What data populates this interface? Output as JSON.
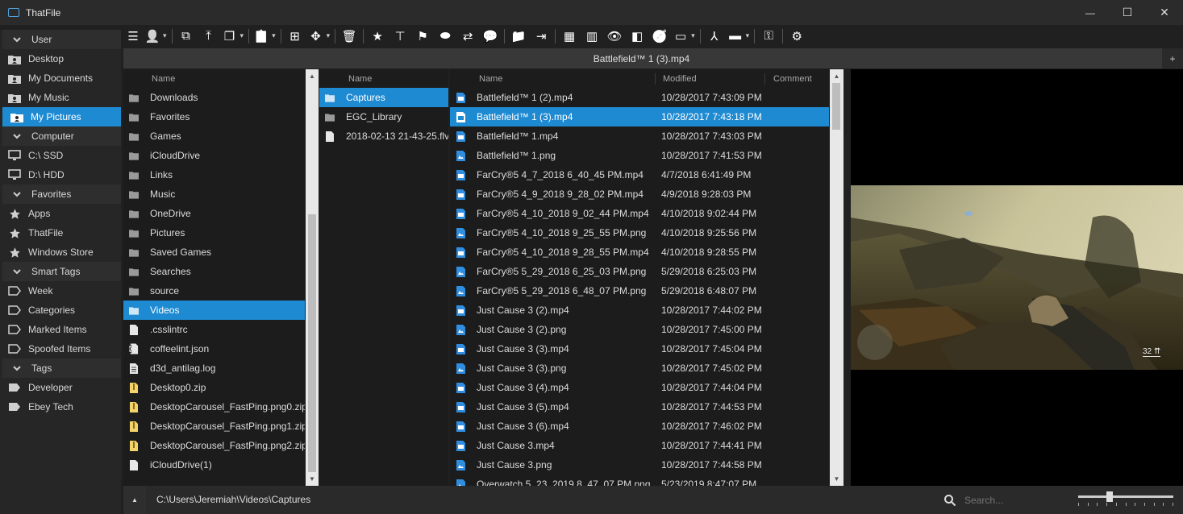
{
  "window": {
    "title": "ThatFile",
    "controls": {
      "minimize": "—",
      "maximize": "☐",
      "close": "✕"
    }
  },
  "sidebar": {
    "items": [
      {
        "label": "User",
        "kind": "header",
        "icon": "chevron-down"
      },
      {
        "label": "Desktop",
        "kind": "item",
        "icon": "user-folder"
      },
      {
        "label": "My Documents",
        "kind": "item",
        "icon": "user-folder"
      },
      {
        "label": "My Music",
        "kind": "item",
        "icon": "user-folder"
      },
      {
        "label": "My Pictures",
        "kind": "item",
        "icon": "user-folder",
        "active": true
      },
      {
        "label": "Computer",
        "kind": "header",
        "icon": "chevron-down"
      },
      {
        "label": "C:\\ SSD",
        "kind": "item",
        "icon": "monitor"
      },
      {
        "label": "D:\\ HDD",
        "kind": "item",
        "icon": "monitor"
      },
      {
        "label": "Favorites",
        "kind": "header",
        "icon": "chevron-down"
      },
      {
        "label": "Apps",
        "kind": "item",
        "icon": "star"
      },
      {
        "label": "ThatFile",
        "kind": "item",
        "icon": "star"
      },
      {
        "label": "Windows Store",
        "kind": "item",
        "icon": "star"
      },
      {
        "label": "Smart Tags",
        "kind": "header",
        "icon": "chevron-down"
      },
      {
        "label": "Week",
        "kind": "item",
        "icon": "tag-outline"
      },
      {
        "label": "Categories",
        "kind": "item",
        "icon": "tag-outline"
      },
      {
        "label": "Marked Items",
        "kind": "item",
        "icon": "tag-outline"
      },
      {
        "label": "Spoofed Items",
        "kind": "item",
        "icon": "tag-outline"
      },
      {
        "label": "Tags",
        "kind": "header",
        "icon": "chevron-down"
      },
      {
        "label": "Developer",
        "kind": "item",
        "icon": "tag"
      },
      {
        "label": "Ebey Tech",
        "kind": "item",
        "icon": "tag"
      }
    ]
  },
  "toolbar": {
    "buttons": [
      {
        "name": "menu",
        "glyph": "☰",
        "w": 24
      },
      {
        "name": "user",
        "glyph": "👤",
        "w": 24,
        "dropdown": true
      },
      {
        "sep": true
      },
      {
        "name": "open-external",
        "glyph": "⧉",
        "w": 28
      },
      {
        "name": "move-up",
        "glyph": "⤒",
        "w": 28
      },
      {
        "name": "copy",
        "glyph": "❐",
        "w": 24,
        "dropdown": true
      },
      {
        "sep": true
      },
      {
        "name": "paste",
        "glyph": "📋",
        "w": 24,
        "dropdown": true
      },
      {
        "sep": true
      },
      {
        "name": "new-item",
        "glyph": "⊞",
        "w": 28
      },
      {
        "name": "move",
        "glyph": "✥",
        "w": 24,
        "dropdown": true
      },
      {
        "sep": true
      },
      {
        "name": "delete",
        "glyph": "🗑",
        "w": 28
      },
      {
        "sep": true
      },
      {
        "name": "favorite",
        "glyph": "★",
        "w": 28
      },
      {
        "name": "pin-top",
        "glyph": "⊤",
        "w": 28
      },
      {
        "name": "flag",
        "glyph": "⚑",
        "w": 28
      },
      {
        "name": "tag",
        "glyph": "⬬",
        "w": 28
      },
      {
        "name": "swap",
        "glyph": "⇄",
        "w": 28
      },
      {
        "name": "comment",
        "glyph": "💬",
        "w": 28
      },
      {
        "sep": true
      },
      {
        "name": "folder",
        "glyph": "📁",
        "w": 28
      },
      {
        "name": "open-in",
        "glyph": "⇥",
        "w": 28
      },
      {
        "sep": true
      },
      {
        "name": "tiles-view",
        "glyph": "▦",
        "w": 28
      },
      {
        "name": "columns-view",
        "glyph": "▥",
        "w": 28
      },
      {
        "name": "preview-eye",
        "glyph": "👁",
        "w": 28
      },
      {
        "name": "compare",
        "glyph": "◧",
        "w": 28
      },
      {
        "name": "compass",
        "glyph": "🧭",
        "w": 28
      },
      {
        "name": "window",
        "glyph": "▭",
        "w": 24,
        "dropdown": true
      },
      {
        "sep": true
      },
      {
        "name": "merge",
        "glyph": "⅄",
        "w": 28
      },
      {
        "name": "bar",
        "glyph": "▬",
        "w": 24,
        "dropdown": true
      },
      {
        "sep": true
      },
      {
        "name": "key",
        "glyph": "⚿",
        "w": 28
      },
      {
        "sep": true
      },
      {
        "name": "settings",
        "glyph": "⚙",
        "w": 28
      }
    ]
  },
  "tab": {
    "title": "Battlefield™ 1 (3).mp4",
    "add_label": "+"
  },
  "pane1": {
    "header": "Name",
    "rows": [
      {
        "name": "Downloads",
        "icon": "folder"
      },
      {
        "name": "Favorites",
        "icon": "folder"
      },
      {
        "name": "Games",
        "icon": "folder"
      },
      {
        "name": "iCloudDrive",
        "icon": "folder"
      },
      {
        "name": "Links",
        "icon": "folder"
      },
      {
        "name": "Music",
        "icon": "folder"
      },
      {
        "name": "OneDrive",
        "icon": "folder"
      },
      {
        "name": "Pictures",
        "icon": "folder"
      },
      {
        "name": "Saved Games",
        "icon": "folder"
      },
      {
        "name": "Searches",
        "icon": "folder"
      },
      {
        "name": "source",
        "icon": "folder"
      },
      {
        "name": "Videos",
        "icon": "folder",
        "selected": true
      },
      {
        "name": ".csslintrc",
        "icon": "file"
      },
      {
        "name": "coffeelint.json",
        "icon": "json"
      },
      {
        "name": "d3d_antilag.log",
        "icon": "text"
      },
      {
        "name": "Desktop0.zip",
        "icon": "zip"
      },
      {
        "name": "DesktopCarousel_FastPing.png0.zip",
        "icon": "zip"
      },
      {
        "name": "DesktopCarousel_FastPing.png1.zip",
        "icon": "zip"
      },
      {
        "name": "DesktopCarousel_FastPing.png2.zip",
        "icon": "zip"
      },
      {
        "name": "iCloudDrive(1)",
        "icon": "file"
      }
    ]
  },
  "pane2": {
    "header": "Name",
    "rows": [
      {
        "name": "Captures",
        "icon": "folder",
        "selected": true
      },
      {
        "name": "EGC_Library",
        "icon": "folder"
      },
      {
        "name": "2018-02-13 21-43-25.flv",
        "icon": "file"
      }
    ]
  },
  "pane3": {
    "headers": {
      "name": "Name",
      "modified": "Modified",
      "comment": "Comment"
    },
    "rows": [
      {
        "name": "Battlefield™ 1 (2).mp4",
        "modified": "10/28/2017 7:43:09 PM",
        "icon": "video"
      },
      {
        "name": "Battlefield™ 1 (3).mp4",
        "modified": "10/28/2017 7:43:18 PM",
        "icon": "video",
        "selected": true
      },
      {
        "name": "Battlefield™ 1.mp4",
        "modified": "10/28/2017 7:43:03 PM",
        "icon": "video"
      },
      {
        "name": "Battlefield™ 1.png",
        "modified": "10/28/2017 7:41:53 PM",
        "icon": "image"
      },
      {
        "name": "FarCry®5 4_7_2018 6_40_45 PM.mp4",
        "modified": "4/7/2018 6:41:49 PM",
        "icon": "video"
      },
      {
        "name": "FarCry®5 4_9_2018 9_28_02 PM.mp4",
        "modified": "4/9/2018 9:28:03 PM",
        "icon": "video"
      },
      {
        "name": "FarCry®5 4_10_2018 9_02_44 PM.mp4",
        "modified": "4/10/2018 9:02:44 PM",
        "icon": "video"
      },
      {
        "name": "FarCry®5 4_10_2018 9_25_55 PM.png",
        "modified": "4/10/2018 9:25:56 PM",
        "icon": "image"
      },
      {
        "name": "FarCry®5 4_10_2018 9_28_55 PM.mp4",
        "modified": "4/10/2018 9:28:55 PM",
        "icon": "video"
      },
      {
        "name": "FarCry®5 5_29_2018 6_25_03 PM.png",
        "modified": "5/29/2018 6:25:03 PM",
        "icon": "image"
      },
      {
        "name": "FarCry®5 5_29_2018 6_48_07 PM.png",
        "modified": "5/29/2018 6:48:07 PM",
        "icon": "image"
      },
      {
        "name": "Just Cause 3 (2).mp4",
        "modified": "10/28/2017 7:44:02 PM",
        "icon": "video"
      },
      {
        "name": "Just Cause 3 (2).png",
        "modified": "10/28/2017 7:45:00 PM",
        "icon": "image"
      },
      {
        "name": "Just Cause 3 (3).mp4",
        "modified": "10/28/2017 7:45:04 PM",
        "icon": "video"
      },
      {
        "name": "Just Cause 3 (3).png",
        "modified": "10/28/2017 7:45:02 PM",
        "icon": "image"
      },
      {
        "name": "Just Cause 3 (4).mp4",
        "modified": "10/28/2017 7:44:04 PM",
        "icon": "video"
      },
      {
        "name": "Just Cause 3 (5).mp4",
        "modified": "10/28/2017 7:44:53 PM",
        "icon": "video"
      },
      {
        "name": "Just Cause 3 (6).mp4",
        "modified": "10/28/2017 7:46:02 PM",
        "icon": "video"
      },
      {
        "name": "Just Cause 3.mp4",
        "modified": "10/28/2017 7:44:41 PM",
        "icon": "video"
      },
      {
        "name": "Just Cause 3.png",
        "modified": "10/28/2017 7:44:58 PM",
        "icon": "image"
      },
      {
        "name": "Overwatch 5_23_2019 8_47_07 PM.png",
        "modified": "5/23/2019 8:47:07 PM",
        "icon": "image"
      }
    ]
  },
  "preview": {
    "hud_text": "32 ⇈"
  },
  "statusbar": {
    "toggle": "▲",
    "path": "C:\\Users\\Jeremiah\\Videos\\Captures",
    "search_placeholder": "Search...",
    "zoom_level": 0.2
  }
}
